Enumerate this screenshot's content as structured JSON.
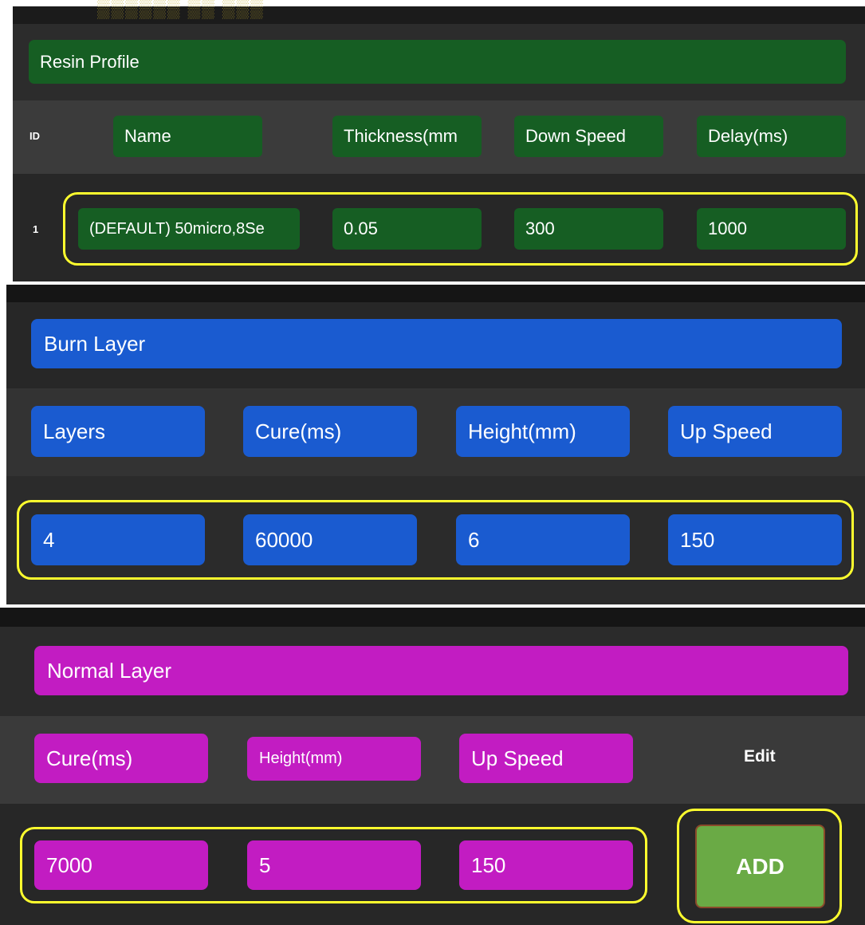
{
  "resin_profile": {
    "title": "Resin Profile",
    "id_header": "ID",
    "columns": [
      "Name",
      "Thickness(mm",
      "Down Speed",
      "Delay(ms)"
    ],
    "row": {
      "id": "1",
      "name": "(DEFAULT) 50micro,8Se",
      "thickness": "0.05",
      "down_speed": "300",
      "delay": "1000"
    }
  },
  "burn_layer": {
    "title": "Burn Layer",
    "columns": [
      "Layers",
      "Cure(ms)",
      "Height(mm)",
      "Up Speed"
    ],
    "values": {
      "layers": "4",
      "cure": "60000",
      "height": "6",
      "up_speed": "150"
    }
  },
  "normal_layer": {
    "title": "Normal Layer",
    "columns": [
      "Cure(ms)",
      "Height(mm)",
      "Up Speed"
    ],
    "edit_label": "Edit",
    "values": {
      "cure": "7000",
      "height": "5",
      "up_speed": "150"
    },
    "add_label": "ADD"
  },
  "colors": {
    "resin_accent": "#165e23",
    "burn_accent": "#1a5bd0",
    "normal_accent": "#c21cc2",
    "add_button": "#6aaa45",
    "highlight": "#ffff2e"
  }
}
